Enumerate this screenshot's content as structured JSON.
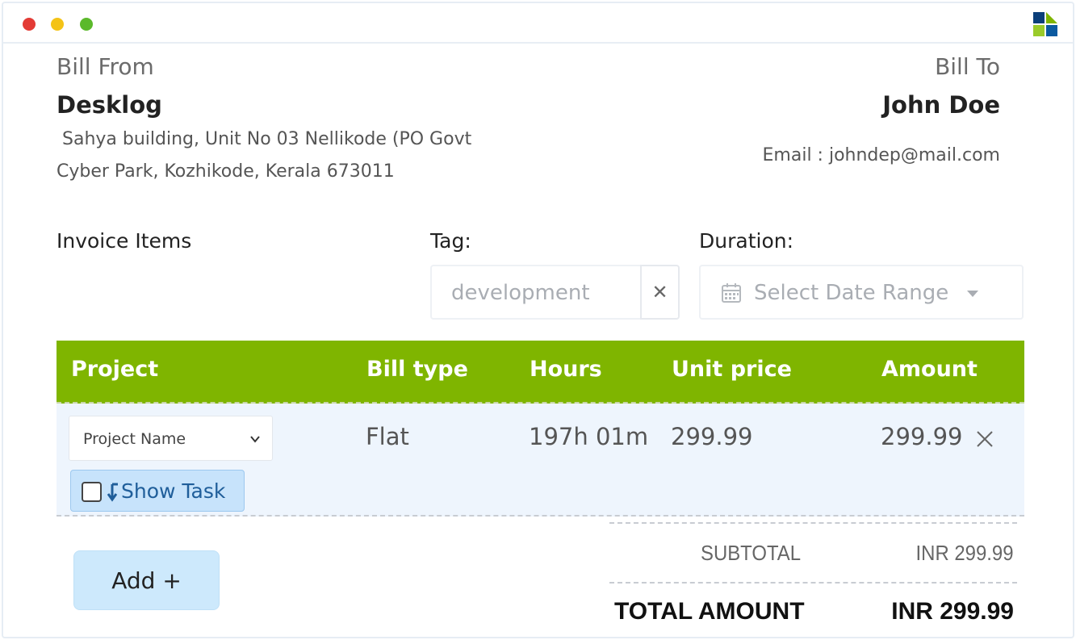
{
  "window": {
    "controls": {
      "close_color": "#e33b35",
      "minimize_color": "#f4c316",
      "maximize_color": "#5bb92b"
    },
    "logo_icon": "grid-logo-icon",
    "logo_colors": [
      "#0b5aa0",
      "#7fb500",
      "#0b3f7a",
      "#9acb2a"
    ]
  },
  "bill_from": {
    "label": "Bill From",
    "name": "Desklog",
    "address_line1": "Sahya building, Unit No 03 Nellikode (PO Govt",
    "address_line2": "Cyber Park, Kozhikode, Kerala 673011"
  },
  "bill_to": {
    "label": "Bill To",
    "name": "John Doe",
    "email": "Email : johndep@mail.com"
  },
  "filters": {
    "section_label": "Invoice Items",
    "tag_label": "Tag:",
    "tag_value": "development",
    "tag_clear_icon": "close-icon",
    "duration_label": "Duration:",
    "date_placeholder": "Select Date Range",
    "date_icon": "calendar-icon"
  },
  "table": {
    "accent": "#7fb500",
    "headers": [
      "Project",
      "Bill type",
      "Hours",
      "Unit price",
      "Amount"
    ],
    "rows": [
      {
        "project_placeholder": "Project Name",
        "show_task_label": "Show Task",
        "bill_type": "Flat",
        "hours": "197h 01m",
        "unit_price": "299.99",
        "amount": "299.99"
      }
    ]
  },
  "summary": {
    "subtotal_label": "SUBTOTAL",
    "subtotal_value": "INR 299.99",
    "total_label": "TOTAL AMOUNT",
    "total_value": "INR 299.99"
  },
  "actions": {
    "add_label": "Add +"
  }
}
